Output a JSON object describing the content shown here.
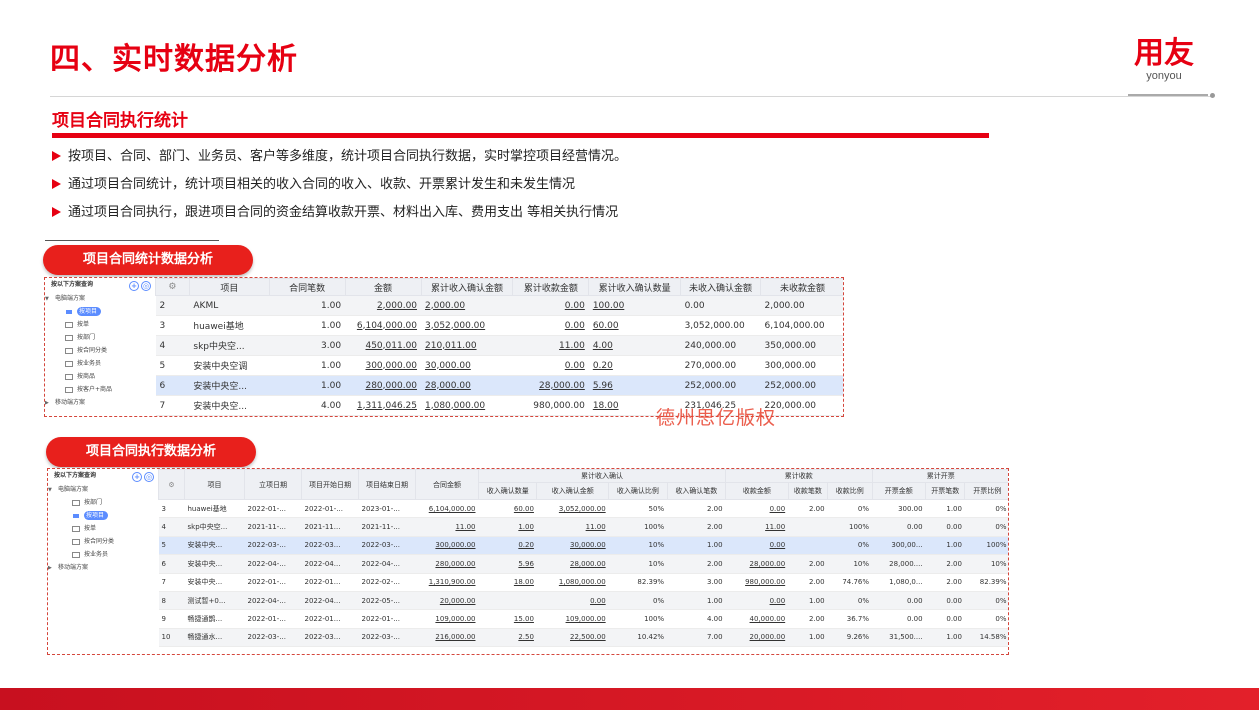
{
  "slide": {
    "title": "四、实时数据分析",
    "brand_logo": "用友",
    "brand_sub": "yonyou",
    "section_title": "项目合同执行统计",
    "bullets": [
      "按项目、合同、部门、业务员、客户等多维度，统计项目合同执行数据，实时掌控项目经营情况。",
      "通过项目合同统计，统计项目相关的收入合同的收入、收款、开票累计发生和未发生情况",
      "通过项目合同执行，跟进项目合同的资金结算收款开票、材料出入库、费用支出 等相关执行情况"
    ],
    "watermark": "德州思亿版权",
    "accent_color": "#e60012"
  },
  "stats_panel": {
    "pill_label": "项目合同统计数据分析",
    "sidebar": {
      "header": "按以下方案查询",
      "add_icon": "+",
      "items": [
        {
          "label": "电脑端方案",
          "icon": "caret-down-icon"
        },
        {
          "label": "按项目",
          "icon": "clock-icon",
          "selected": true
        },
        {
          "label": "按单",
          "icon": "grid-icon"
        },
        {
          "label": "按部门",
          "icon": "list-icon"
        },
        {
          "label": "按合同分类",
          "icon": "table-icon"
        },
        {
          "label": "按业务员",
          "icon": "chart-icon"
        },
        {
          "label": "按商品",
          "icon": "doc-icon"
        },
        {
          "label": "按客户+商品",
          "icon": "doc-icon"
        },
        {
          "label": "移动端方案",
          "icon": "caret-right-icon"
        }
      ]
    },
    "columns": [
      "项目",
      "合同笔数",
      "金额",
      "累计收入确认金额",
      "累计收款金额",
      "累计收入确认数量",
      "未收入确认金额",
      "未收款金额"
    ],
    "rows": [
      {
        "no": "2",
        "cells": [
          "AKML",
          "1.00",
          "2,000.00",
          "2,000.00",
          "0.00",
          "100.00",
          "0.00",
          "2,000.00"
        ]
      },
      {
        "no": "3",
        "cells": [
          "huawei基地",
          "1.00",
          "6,104,000.00",
          "3,052,000.00",
          "0.00",
          "60.00",
          "3,052,000.00",
          "6,104,000.00"
        ]
      },
      {
        "no": "4",
        "cells": [
          "skp中央空...",
          "3.00",
          "450,011.00",
          "210,011.00",
          "11.00",
          "4.00",
          "240,000.00",
          "350,000.00"
        ]
      },
      {
        "no": "5",
        "cells": [
          "安装中央空调",
          "1.00",
          "300,000.00",
          "30,000.00",
          "0.00",
          "0.20",
          "270,000.00",
          "300,000.00"
        ]
      },
      {
        "no": "6",
        "cells": [
          "安装中央空...",
          "1.00",
          "280,000.00",
          "28,000.00",
          "28,000.00",
          "5.96",
          "252,000.00",
          "252,000.00"
        ]
      },
      {
        "no": "7",
        "cells": [
          "安装中央空...",
          "4.00",
          "1,311,046.25",
          "1,080,000.00",
          "980,000.00",
          "18.00",
          "231,046.25",
          "220,000.00"
        ]
      }
    ]
  },
  "exec_panel": {
    "pill_label": "项目合同执行数据分析",
    "sidebar": {
      "header": "按以下方案查询",
      "items": [
        {
          "label": "电脑端方案",
          "icon": "caret-down-icon"
        },
        {
          "label": "按部门",
          "icon": "clock-icon"
        },
        {
          "label": "按项目",
          "icon": "chart-icon",
          "selected": true
        },
        {
          "label": "按单",
          "icon": "list-icon"
        },
        {
          "label": "按合同分类",
          "icon": "table-icon"
        },
        {
          "label": "按业务员",
          "icon": "chart-icon"
        },
        {
          "label": "移动端方案",
          "icon": "caret-right-icon"
        }
      ]
    },
    "group_headers": [
      "累计收入确认",
      "累计收款",
      "累计开票"
    ],
    "base_columns": [
      "项目",
      "立项日期",
      "项目开始日期",
      "项目结束日期",
      "合同金额"
    ],
    "sub_columns": [
      "收入确认数量",
      "收入确认金额",
      "收入确认比例",
      "收入确认笔数",
      "收款金额",
      "收款笔数",
      "收款比例",
      "开票金额",
      "开票笔数",
      "开票比例"
    ],
    "rows": [
      {
        "no": "3",
        "cells": [
          "huawei基地",
          "2022-01-...",
          "2022-01-...",
          "2023-01-...",
          "6,104,000.00",
          "60.00",
          "3,052,000.00",
          "50%",
          "2.00",
          "0.00",
          "2.00",
          "0%",
          "300.00",
          "1.00",
          "0%"
        ]
      },
      {
        "no": "4",
        "cells": [
          "skp中央空...",
          "2021-11-...",
          "2021-11...",
          "2021-11-...",
          "11.00",
          "1.00",
          "11.00",
          "100%",
          "2.00",
          "11.00",
          "",
          "100%",
          "0.00",
          "0.00",
          "0%"
        ]
      },
      {
        "no": "5",
        "cells": [
          "安装中央...",
          "2022-03-...",
          "2022-03...",
          "2022-03-...",
          "300,000.00",
          "0.20",
          "30,000.00",
          "10%",
          "1.00",
          "0.00",
          "",
          "0%",
          "300,00...",
          "1.00",
          "100%"
        ]
      },
      {
        "no": "6",
        "cells": [
          "安装中央...",
          "2022-04-...",
          "2022-04...",
          "2022-04-...",
          "280,000.00",
          "5.96",
          "28,000.00",
          "10%",
          "2.00",
          "28,000.00",
          "2.00",
          "10%",
          "28,000....",
          "2.00",
          "10%"
        ]
      },
      {
        "no": "7",
        "cells": [
          "安装中央...",
          "2022-01-...",
          "2022-01...",
          "2022-02-...",
          "1,310,900.00",
          "18.00",
          "1,080,000.00",
          "82.39%",
          "3.00",
          "980,000.00",
          "2.00",
          "74.76%",
          "1,080,0...",
          "2.00",
          "82.39%"
        ]
      },
      {
        "no": "8",
        "cells": [
          "测试暂+0...",
          "2022-04-...",
          "2022-04...",
          "2022-05-...",
          "20,000.00",
          "",
          "0.00",
          "0%",
          "1.00",
          "0.00",
          "1.00",
          "0%",
          "0.00",
          "0.00",
          "0%"
        ]
      },
      {
        "no": "9",
        "cells": [
          "畅捷通鹊...",
          "2022-01-...",
          "2022-01...",
          "2022-01-...",
          "109,000.00",
          "15.00",
          "109,000.00",
          "100%",
          "4.00",
          "40,000.00",
          "2.00",
          "36.7%",
          "0.00",
          "0.00",
          "0%"
        ]
      },
      {
        "no": "10",
        "cells": [
          "畅捷通水...",
          "2022-03-...",
          "2022-03...",
          "2022-03-...",
          "216,000.00",
          "2.50",
          "22,500.00",
          "10.42%",
          "7.00",
          "20,000.00",
          "1.00",
          "9.26%",
          "31,500....",
          "1.00",
          "14.58%"
        ]
      }
    ]
  }
}
